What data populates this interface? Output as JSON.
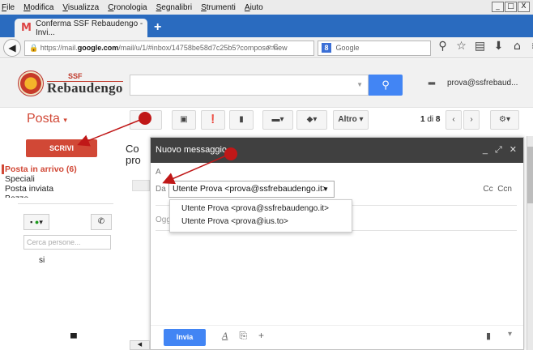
{
  "browser": {
    "menu": [
      "File",
      "Modifica",
      "Visualizza",
      "Cronologia",
      "Segnalibri",
      "Strumenti",
      "Aiuto"
    ],
    "window_controls": [
      "_",
      "□",
      "X"
    ],
    "tab_title": "Conferma SSF Rebaudengo - Invi...",
    "url_host": "https://mail.",
    "url_domain": "google.com",
    "url_path": "/mail/u/1/#inbox/14758be58d7c25b5?compose=new",
    "search_engine": "Google"
  },
  "gmail": {
    "logo_ssf": "SSF",
    "logo_name": "Rebaudengo",
    "user_email": "prova@ssfrebaud...",
    "section_title": "Posta",
    "compose_label": "SCRIVI",
    "nav": [
      "Posta in arrivo (6)",
      "Speciali",
      "Posta inviata",
      "Bozze"
    ],
    "people_placeholder": "Cerca persone...",
    "chat_contact": "si",
    "altro_label": "Altro",
    "page_current": "1",
    "page_sep": "di",
    "page_total": "8",
    "list_subject_line1": "Co",
    "list_subject_line2": "pro"
  },
  "compose": {
    "title": "Nuovo messaggio",
    "to_label": "A",
    "from_label": "Da",
    "from_value": "Utente Prova <prova@ssfrebaudengo.it>",
    "cc_label": "Cc",
    "bcc_label": "Ccn",
    "subject_placeholder": "Ogg",
    "from_options": [
      "Utente Prova <prova@ssfrebaudengo.it>",
      "Utente Prova <prova@ius.to>"
    ],
    "send_label": "Invia"
  },
  "colors": {
    "accent_red": "#d14836",
    "send_blue": "#4285f4",
    "annotation": "#c01818"
  }
}
